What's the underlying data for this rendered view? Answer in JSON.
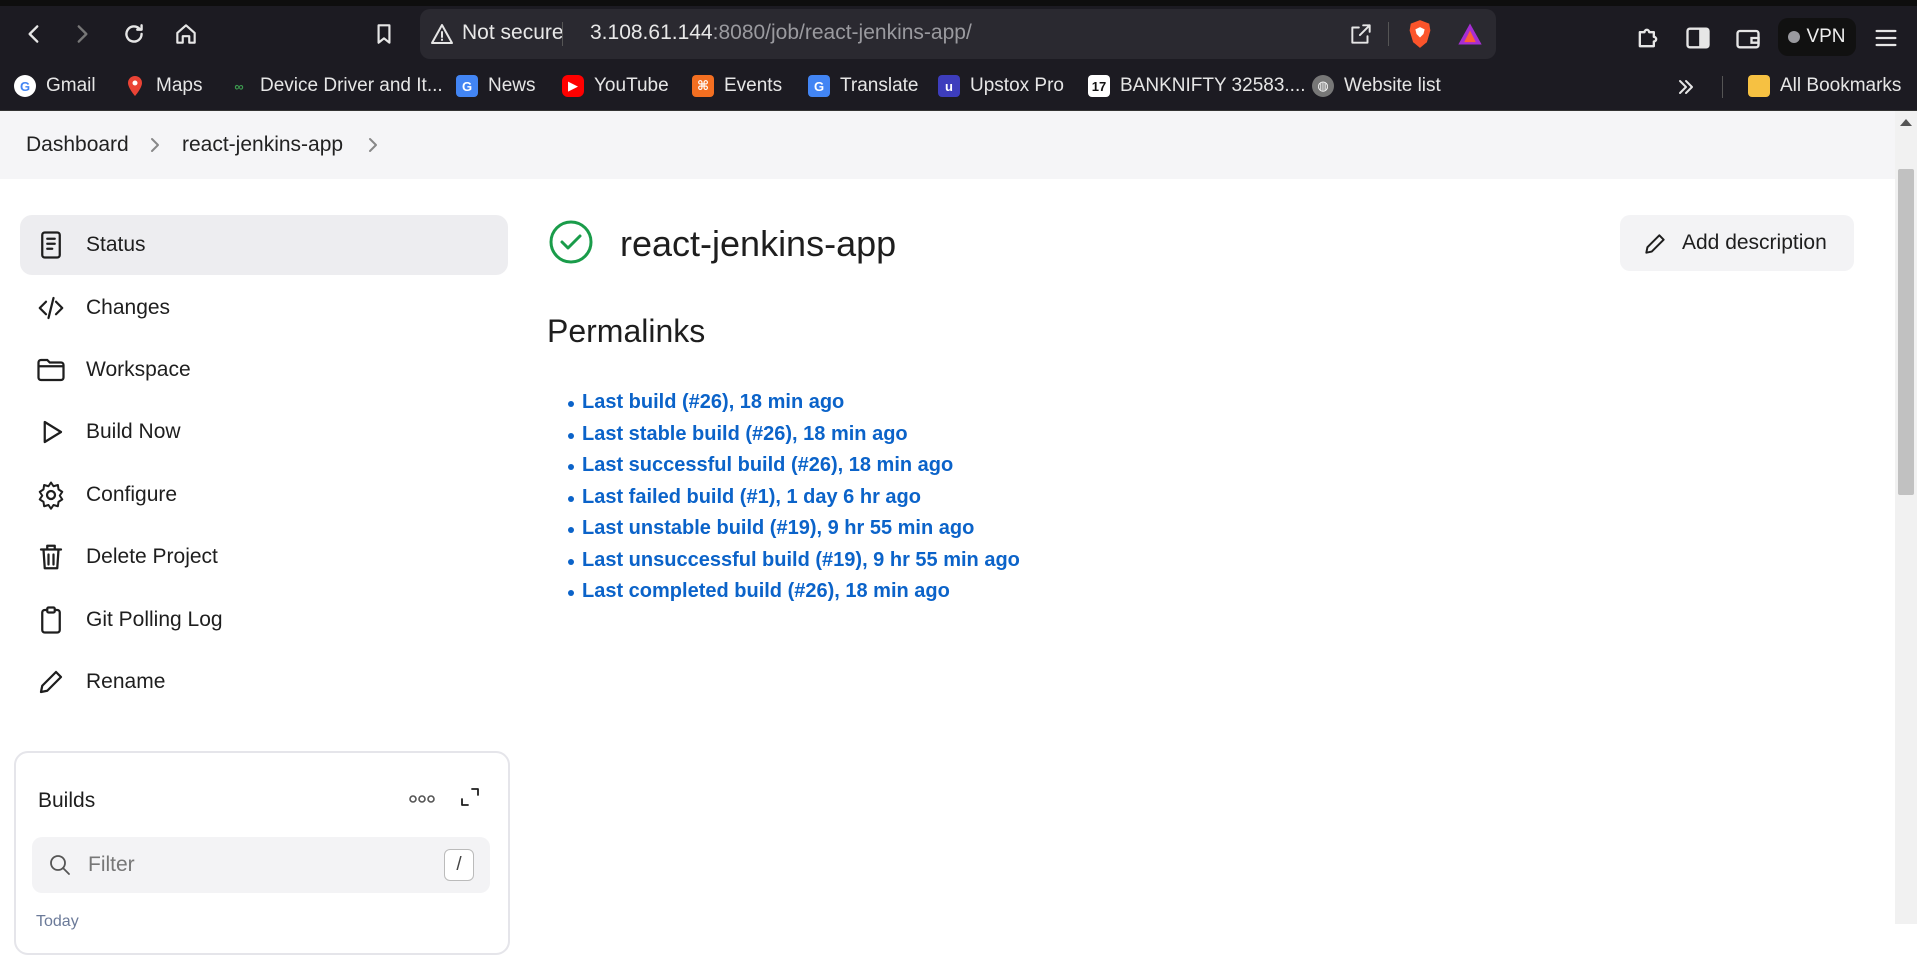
{
  "browser": {
    "not_secure": "Not secure",
    "url_host": "3.108.61.144",
    "url_rest": ":8080/job/react-jenkins-app/",
    "vpn_label": "VPN"
  },
  "bookmarks": [
    {
      "label": "Gmail",
      "icon": "google-icon"
    },
    {
      "label": "Maps",
      "icon": "maps-icon"
    },
    {
      "label": "Device Driver and It...",
      "icon": "driver-icon"
    },
    {
      "label": "News",
      "icon": "news-icon"
    },
    {
      "label": "YouTube",
      "icon": "youtube-icon"
    },
    {
      "label": "Events",
      "icon": "events-icon"
    },
    {
      "label": "Translate",
      "icon": "translate-icon"
    },
    {
      "label": "Upstox Pro",
      "icon": "upstox-icon"
    },
    {
      "label": "BANKNIFTY 32583....",
      "icon": "tradingview-icon"
    },
    {
      "label": "Website list",
      "icon": "globe-icon"
    }
  ],
  "all_bookmarks": "All Bookmarks",
  "breadcrumb": {
    "dashboard": "Dashboard",
    "job": "react-jenkins-app"
  },
  "sidebar": {
    "items": [
      {
        "label": "Status"
      },
      {
        "label": "Changes"
      },
      {
        "label": "Workspace"
      },
      {
        "label": "Build Now"
      },
      {
        "label": "Configure"
      },
      {
        "label": "Delete Project"
      },
      {
        "label": "Git Polling Log"
      },
      {
        "label": "Rename"
      }
    ]
  },
  "job": {
    "title": "react-jenkins-app",
    "add_description": "Add description"
  },
  "permalinks": {
    "title": "Permalinks",
    "items": [
      "Last build (#26), 18 min ago",
      "Last stable build (#26), 18 min ago",
      "Last successful build (#26), 18 min ago",
      "Last failed build (#1), 1 day 6 hr ago",
      "Last unstable build (#19), 9 hr 55 min ago",
      "Last unsuccessful build (#19), 9 hr 55 min ago",
      "Last completed build (#26), 18 min ago"
    ]
  },
  "builds": {
    "title": "Builds",
    "filter_placeholder": "Filter",
    "shortcut": "/",
    "group": "Today"
  },
  "colors": {
    "link": "#0b63c9",
    "success": "#1a9c4a",
    "browser_chrome": "#1c1b22"
  }
}
